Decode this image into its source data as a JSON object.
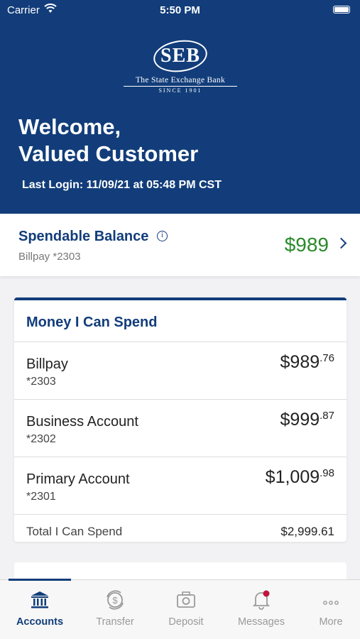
{
  "status_bar": {
    "carrier": "Carrier",
    "time": "5:50 PM"
  },
  "logo": {
    "mark": "SEB",
    "bank_name": "The State Exchange Bank",
    "since": "SINCE 1901"
  },
  "header": {
    "welcome_line1": "Welcome,",
    "welcome_line2": "Valued Customer",
    "last_login": "Last Login: 11/09/21 at 05:48 PM CST"
  },
  "spendable": {
    "title": "Spendable Balance",
    "account": "Billpay *2303",
    "amount": "$989",
    "info_icon": "ⓘ",
    "amount_color": "#2a8a2a"
  },
  "money_card": {
    "title": "Money I Can Spend",
    "accounts": [
      {
        "name": "Billpay",
        "number": "*2303",
        "amount": "$989",
        "cents": ".76"
      },
      {
        "name": "Business Account",
        "number": "*2302",
        "amount": "$999",
        "cents": ".87"
      },
      {
        "name": "Primary Account",
        "number": "*2301",
        "amount": "$1,009",
        "cents": ".98"
      }
    ],
    "total_label": "Total I Can Spend",
    "total_value": "$2,999.61"
  },
  "tabs": [
    {
      "label": "Accounts",
      "icon": "bank-icon",
      "active": true
    },
    {
      "label": "Transfer",
      "icon": "transfer-icon",
      "active": false
    },
    {
      "label": "Deposit",
      "icon": "camera-icon",
      "active": false
    },
    {
      "label": "Messages",
      "icon": "bell-icon",
      "active": false
    },
    {
      "label": "More",
      "icon": "more-icon",
      "active": false
    }
  ],
  "colors": {
    "brand": "#123d7a",
    "positive": "#2a8a2a",
    "badge": "#c0143c"
  }
}
